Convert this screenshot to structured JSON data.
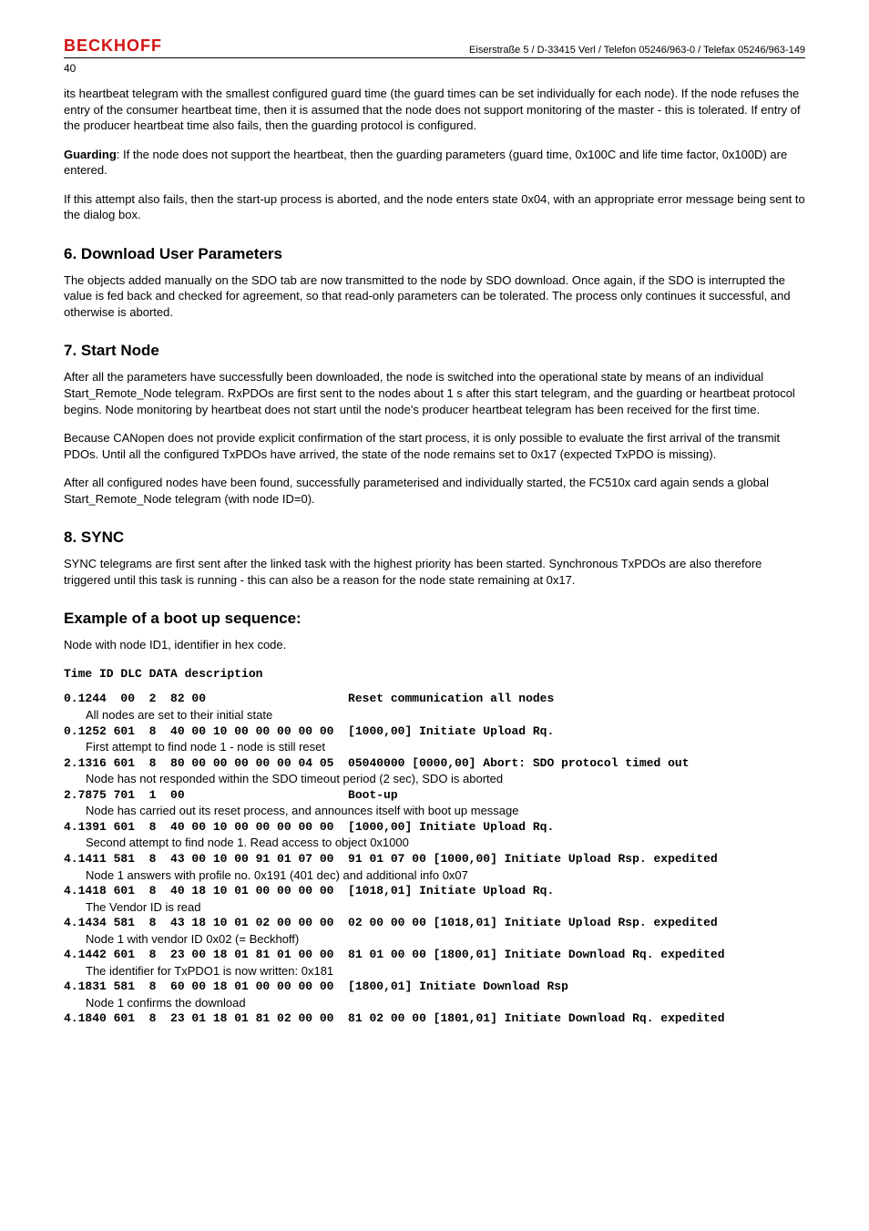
{
  "header": {
    "brand": "BECKHOFF",
    "address": "Eiserstraße 5 / D-33415 Verl / Telefon 05246/963-0 / Telefax 05246/963-149",
    "page": "40"
  },
  "paras": {
    "p1": "its heartbeat telegram with the smallest configured guard time (the guard times can be set individually for each node). If the node refuses the entry of the consumer heartbeat time, then it is assumed that the node does not support monitoring of the master - this is tolerated. If entry of the producer heartbeat time also fails, then the guarding protocol is configured.",
    "p2a": "Guarding",
    "p2b": ": If the node does not support the heartbeat, then the guarding parameters (guard time, 0x100C and life time factor, 0x100D) are entered.",
    "p3": "If this attempt also fails, then the start-up process is aborted, and the node enters state 0x04, with an appropriate error message being sent to the dialog box."
  },
  "h6": "6. Download User Parameters",
  "h6p1": "The objects added manually on the SDO tab are now transmitted to the node by SDO download. Once again, if the SDO is interrupted the value is fed back and checked for agreement, so that read-only parameters can be tolerated. The process only continues it successful, and otherwise is aborted.",
  "h7": "7. Start Node",
  "h7p1": "After all the parameters have successfully been downloaded, the node is switched into the operational state by means of an individual Start_Remote_Node telegram. RxPDOs are first sent to the nodes about 1 s after this start telegram, and the guarding or heartbeat protocol begins. Node monitoring by heartbeat does not start until the node's producer heartbeat telegram has been received for the first time.",
  "h7p2": "Because CANopen does not provide explicit confirmation of the start process, it is only possible to evaluate the first arrival of the transmit PDOs. Until all the configured TxPDOs have arrived, the state of the node remains set to 0x17 (expected TxPDO is missing).",
  "h7p3": "After all configured nodes have been found, successfully parameterised and individually started, the FC510x card again sends a global Start_Remote_Node telegram (with node ID=0).",
  "h8": "8. SYNC",
  "h8p1": "SYNC telegrams are first sent after the linked task with the highest priority has been started. Synchronous TxPDOs are also therefore triggered until this task is running - this can also be a reason for the node state remaining at 0x17.",
  "hEx": "Example of a boot up sequence:",
  "exIntro": "Node with node ID1, identifier in hex code.",
  "tableHeader": "Time ID DLC DATA description",
  "seq": [
    {
      "m": "0.1244  00  2  82 00                    Reset communication all nodes",
      "d": "All nodes are set to their initial state"
    },
    {
      "m": "0.1252 601  8  40 00 10 00 00 00 00 00  [1000,00] Initiate Upload Rq.",
      "d": "First attempt to find node 1 - node is still reset"
    },
    {
      "m": "2.1316 601  8  80 00 00 00 00 00 04 05  05040000 [0000,00] Abort: SDO protocol timed out",
      "d": "Node has not responded within the SDO timeout period (2 sec), SDO is aborted"
    },
    {
      "m": "2.7875 701  1  00                       Boot-up",
      "d": "Node has carried out its reset process, and announces itself with boot up message"
    },
    {
      "m": "4.1391 601  8  40 00 10 00 00 00 00 00  [1000,00] Initiate Upload Rq.",
      "d": "Second attempt to find node 1. Read access to object 0x1000"
    },
    {
      "m": "4.1411 581  8  43 00 10 00 91 01 07 00  91 01 07 00 [1000,00] Initiate Upload Rsp. expedited",
      "d": "Node 1 answers with profile no. 0x191 (401 dec) and additional info 0x07"
    },
    {
      "m": "4.1418 601  8  40 18 10 01 00 00 00 00  [1018,01] Initiate Upload Rq.",
      "d": "The Vendor ID is read"
    },
    {
      "m": "4.1434 581  8  43 18 10 01 02 00 00 00  02 00 00 00 [1018,01] Initiate Upload Rsp. expedited",
      "d": "Node 1 with vendor ID 0x02 (= Beckhoff)"
    },
    {
      "m": "4.1442 601  8  23 00 18 01 81 01 00 00  81 01 00 00 [1800,01] Initiate Download Rq. expedited",
      "d": "The identifier for TxPDO1 is now written: 0x181"
    },
    {
      "m": "4.1831 581  8  60 00 18 01 00 00 00 00  [1800,01] Initiate Download Rsp",
      "d": "Node 1 confirms the download"
    },
    {
      "m": "4.1840 601  8  23 01 18 01 81 02 00 00  81 02 00 00 [1801,01] Initiate Download Rq. expedited",
      "d": ""
    }
  ]
}
